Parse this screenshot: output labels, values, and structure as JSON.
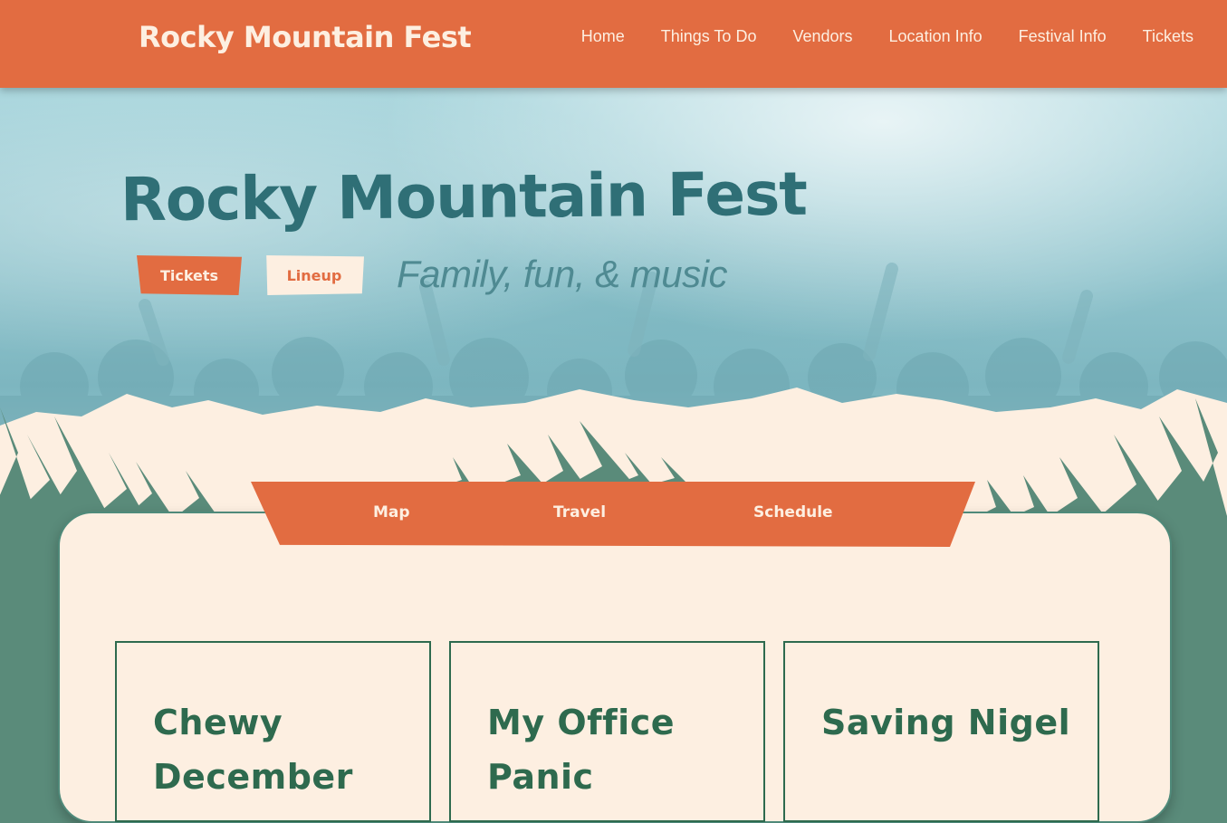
{
  "header": {
    "brand": "Rocky Mountain Fest",
    "nav": [
      "Home",
      "Things To Do",
      "Vendors",
      "Location Info",
      "Festival Info",
      "Tickets"
    ]
  },
  "hero": {
    "title": "Rocky Mountain Fest",
    "tickets_label": "Tickets",
    "lineup_label": "Lineup",
    "tagline": "Family, fun, & music"
  },
  "subnav": {
    "map": "Map",
    "travel": "Travel",
    "schedule": "Schedule"
  },
  "acts": [
    {
      "name": "Chewy December"
    },
    {
      "name": "My Office Panic"
    },
    {
      "name": "Saving Nigel"
    }
  ],
  "colors": {
    "accent": "#e26c41",
    "cream": "#fdefe1",
    "teal": "#2f6f76",
    "forest": "#2e6a4e",
    "pine": "#5a8b7a"
  }
}
